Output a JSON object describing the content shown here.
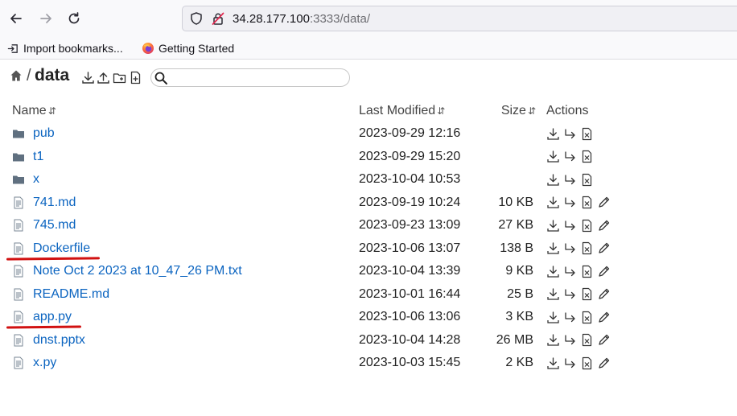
{
  "browser": {
    "url_host": "34.28.177.100",
    "url_rest": ":3333/data/",
    "bookmarks": [
      {
        "label": "Import bookmarks...",
        "icon": "import-icon"
      },
      {
        "label": "Getting Started",
        "icon": "firefox-icon"
      }
    ]
  },
  "header": {
    "crumb_separator": "/",
    "crumb": "data",
    "search_placeholder": ""
  },
  "columns": {
    "name": "Name",
    "modified": "Last Modified",
    "size": "Size",
    "actions": "Actions",
    "sort_glyph": "⇵"
  },
  "files": [
    {
      "name": "pub",
      "type": "folder",
      "modified": "2023-09-29 12:16",
      "size": "",
      "editable": false
    },
    {
      "name": "t1",
      "type": "folder",
      "modified": "2023-09-29 15:20",
      "size": "",
      "editable": false
    },
    {
      "name": "x",
      "type": "folder",
      "modified": "2023-10-04 10:53",
      "size": "",
      "editable": false
    },
    {
      "name": "741.md",
      "type": "file",
      "modified": "2023-09-19 10:24",
      "size": "10 KB",
      "editable": true
    },
    {
      "name": "745.md",
      "type": "file",
      "modified": "2023-09-23 13:09",
      "size": "27 KB",
      "editable": true
    },
    {
      "name": "Dockerfile",
      "type": "file",
      "modified": "2023-10-06 13:07",
      "size": "138 B",
      "editable": true
    },
    {
      "name": "Note Oct 2 2023 at 10_47_26 PM.txt",
      "type": "file",
      "modified": "2023-10-04 13:39",
      "size": "9 KB",
      "editable": true
    },
    {
      "name": "README.md",
      "type": "file",
      "modified": "2023-10-01 16:44",
      "size": "25 B",
      "editable": true
    },
    {
      "name": "app.py",
      "type": "file",
      "modified": "2023-10-06 13:06",
      "size": "3 KB",
      "editable": true
    },
    {
      "name": "dnst.pptx",
      "type": "file",
      "modified": "2023-10-04 14:28",
      "size": "26 MB",
      "editable": true
    },
    {
      "name": "x.py",
      "type": "file",
      "modified": "2023-10-03 15:45",
      "size": "2 KB",
      "editable": true
    }
  ],
  "annotations": [
    {
      "target": "Dockerfile",
      "color": "#d11111"
    },
    {
      "target": "app.py",
      "color": "#d11111"
    }
  ]
}
